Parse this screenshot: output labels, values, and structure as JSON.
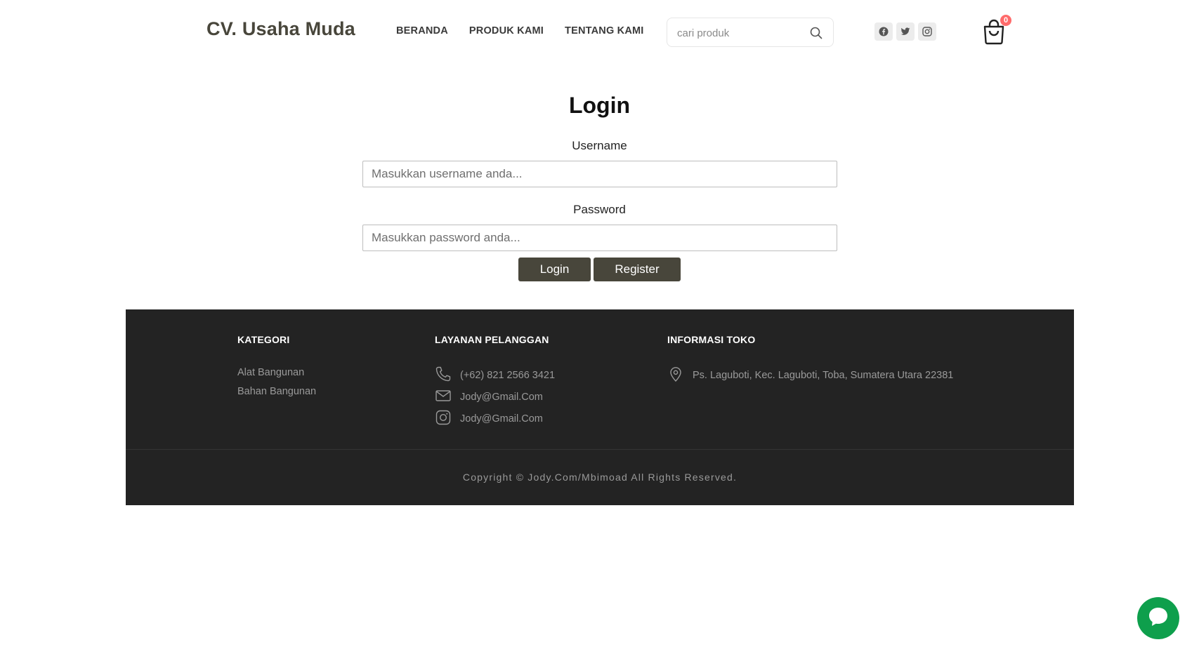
{
  "header": {
    "brand": "CV. Usaha Muda",
    "nav": [
      "BERANDA",
      "PRODUK KAMI",
      "TENTANG KAMI"
    ],
    "search_placeholder": "cari produk",
    "socials": [
      "facebook-icon",
      "twitter-icon",
      "instagram-icon"
    ],
    "cart_count": "0"
  },
  "login": {
    "title": "Login",
    "username_label": "Username",
    "username_placeholder": "Masukkan username anda...",
    "password_label": "Password",
    "password_placeholder": "Masukkan password anda...",
    "login_button": "Login",
    "register_button": "Register",
    "button_color": "#48463b"
  },
  "footer": {
    "kategori": {
      "heading": "KATEGORI",
      "items": [
        "Alat Bangunan",
        "Bahan Bangunan"
      ]
    },
    "layanan": {
      "heading": "LAYANAN PELANGGAN",
      "phone": "(+62) 821 2566 3421",
      "email": "Jody@Gmail.Com",
      "instagram": "Jody@Gmail.Com"
    },
    "informasi": {
      "heading": "INFORMASI TOKO",
      "address": "Ps. Laguboti, Kec. Laguboti, Toba, Sumatera Utara 22381"
    },
    "copyright": "Copyright © Jody.Com/Mbimoad All Rights Reserved.",
    "background": "#232323"
  },
  "chat": {
    "icon": "chat-bubble-icon",
    "color": "#0e9f4c"
  }
}
